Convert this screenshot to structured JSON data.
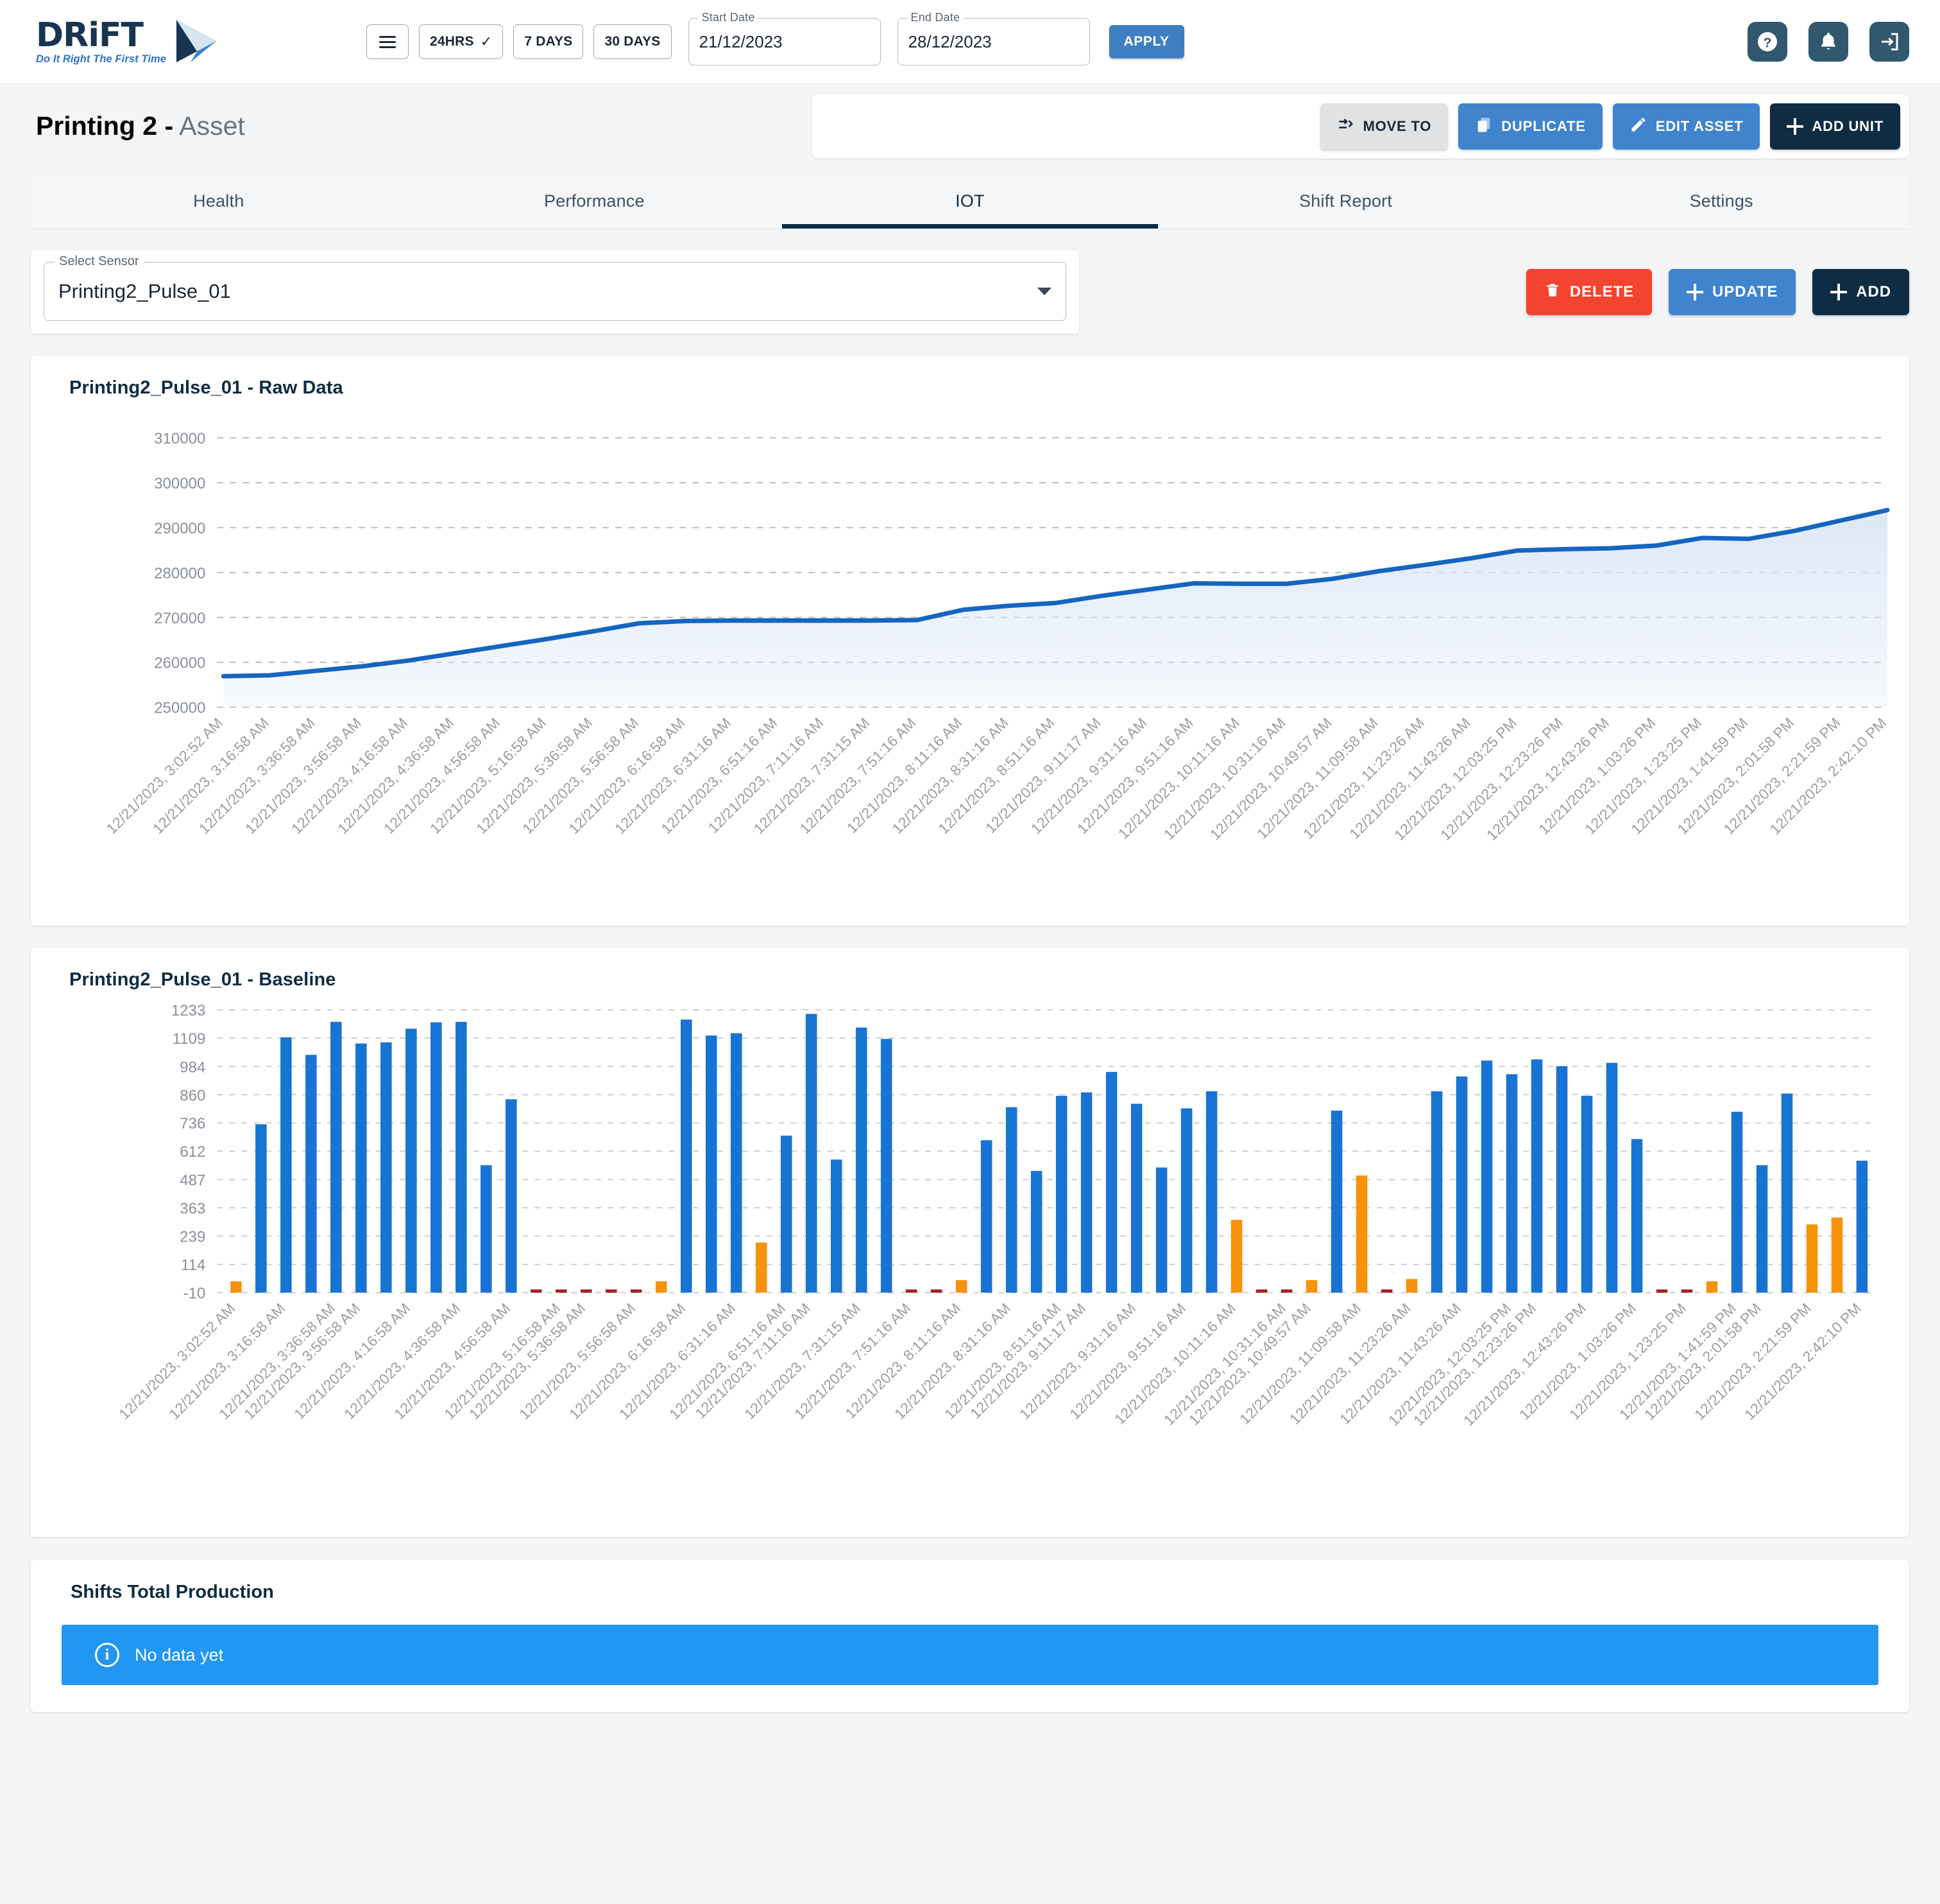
{
  "brand": {
    "name": "DRiFT",
    "tagline": "Do It Right The First Time"
  },
  "header": {
    "menu_icon": "hamburger-menu-icon",
    "ranges": [
      {
        "label": "24HRS",
        "selected": true,
        "check": "✓"
      },
      {
        "label": "7 DAYS",
        "selected": false
      },
      {
        "label": "30 DAYS",
        "selected": false
      }
    ],
    "start_date": {
      "label": "Start Date",
      "value": "21/12/2023"
    },
    "end_date": {
      "label": "End Date",
      "value": "28/12/2023"
    },
    "apply_label": "APPLY",
    "icons": [
      "help-icon",
      "notifications-bell-icon",
      "logout-icon"
    ],
    "accent_blue": "#3f7fc1",
    "icon_tile_color": "#31586e"
  },
  "page": {
    "title_bold": "Printing 2 -",
    "title_muted": "Asset",
    "actions": [
      {
        "label": "MOVE TO",
        "icon": "move-to-icon",
        "style": "grey"
      },
      {
        "label": "DUPLICATE",
        "icon": "duplicate-icon",
        "style": "blue"
      },
      {
        "label": "EDIT ASSET",
        "icon": "pencil-icon",
        "style": "blue"
      },
      {
        "label": "ADD UNIT",
        "icon": "plus-icon",
        "style": "navy"
      }
    ]
  },
  "tabs": [
    {
      "label": "Health",
      "active": false
    },
    {
      "label": "Performance",
      "active": false
    },
    {
      "label": "IOT",
      "active": true
    },
    {
      "label": "Shift Report",
      "active": false
    },
    {
      "label": "Settings",
      "active": false
    }
  ],
  "sensor": {
    "label": "Select Sensor",
    "value": "Printing2_Pulse_01",
    "actions": [
      {
        "label": "DELETE",
        "icon": "trash-icon",
        "style": "red"
      },
      {
        "label": "UPDATE",
        "icon": "plus-icon",
        "style": "blue"
      },
      {
        "label": "ADD",
        "icon": "plus-icon",
        "style": "navy"
      }
    ]
  },
  "shifts": {
    "title": "Shifts Total Production",
    "no_data_text": "No data yet",
    "info_icon": "info-icon",
    "banner_color": "#2196f3"
  },
  "chart_data": [
    {
      "id": "raw",
      "type": "area",
      "title": "Printing2_Pulse_01 - Raw Data",
      "xlabel": "",
      "ylabel": "",
      "ylim": [
        250000,
        313000
      ],
      "yticks": [
        250000,
        260000,
        270000,
        280000,
        290000,
        300000,
        310000
      ],
      "grid": true,
      "legend": "none",
      "line_color": "#1565c0",
      "fill_color": "#dbe7f7",
      "x": [
        "12/21/2023, 3:02:52 AM",
        "12/21/2023, 3:16:58 AM",
        "12/21/2023, 3:36:58 AM",
        "12/21/2023, 3:56:58 AM",
        "12/21/2023, 4:16:58 AM",
        "12/21/2023, 4:36:58 AM",
        "12/21/2023, 4:56:58 AM",
        "12/21/2023, 5:16:58 AM",
        "12/21/2023, 5:36:58 AM",
        "12/21/2023, 5:56:58 AM",
        "12/21/2023, 6:16:58 AM",
        "12/21/2023, 6:31:16 AM",
        "12/21/2023, 6:51:16 AM",
        "12/21/2023, 7:11:16 AM",
        "12/21/2023, 7:31:15 AM",
        "12/21/2023, 7:51:16 AM",
        "12/21/2023, 8:11:16 AM",
        "12/21/2023, 8:31:16 AM",
        "12/21/2023, 8:51:16 AM",
        "12/21/2023, 9:11:17 AM",
        "12/21/2023, 9:31:16 AM",
        "12/21/2023, 9:51:16 AM",
        "12/21/2023, 10:11:16 AM",
        "12/21/2023, 10:31:16 AM",
        "12/21/2023, 10:49:57 AM",
        "12/21/2023, 11:09:58 AM",
        "12/21/2023, 11:23:26 AM",
        "12/21/2023, 11:43:26 AM",
        "12/21/2023, 12:03:25 PM",
        "12/21/2023, 12:23:26 PM",
        "12/21/2023, 12:43:26 PM",
        "12/21/2023, 1:03:26 PM",
        "12/21/2023, 1:23:25 PM",
        "12/21/2023, 1:41:59 PM",
        "12/21/2023, 2:01:58 PM",
        "12/21/2023, 2:21:59 PM",
        "12/21/2023, 2:42:10 PM"
      ],
      "y": [
        256900,
        257100,
        258100,
        259100,
        260400,
        262000,
        263600,
        265200,
        266900,
        268700,
        269200,
        269300,
        269300,
        269300,
        269300,
        269400,
        271700,
        272600,
        273200,
        274800,
        276200,
        277600,
        277500,
        277500,
        278600,
        280300,
        281700,
        283200,
        284900,
        285200,
        285400,
        286000,
        287700,
        287500,
        289300,
        291600,
        293900
      ]
    },
    {
      "id": "baseline",
      "type": "bar",
      "title": "Printing2_Pulse_01 - Baseline",
      "xlabel": "",
      "ylabel": "",
      "ylim": [
        -10,
        1233
      ],
      "yticks": [
        -10,
        114,
        239,
        363,
        487,
        612,
        736,
        860,
        984,
        1109,
        1233
      ],
      "grid": true,
      "legend": "none",
      "colors": {
        "primary": "#1874d2",
        "secondary": "#f7920b",
        "zero": "#a32020"
      },
      "categories": [
        "12/21/2023, 3:02:52 AM",
        "12/21/2023, 3:16:58 AM",
        "12/21/2023, 3:36:58 AM",
        "12/21/2023, 3:56:58 AM",
        "12/21/2023, 4:16:58 AM",
        "12/21/2023, 4:36:58 AM",
        "12/21/2023, 4:56:58 AM",
        "12/21/2023, 5:16:58 AM",
        "12/21/2023, 5:36:58 AM",
        "12/21/2023, 5:56:58 AM",
        "12/21/2023, 6:16:58 AM",
        "12/21/2023, 6:31:16 AM",
        "12/21/2023, 6:51:16 AM",
        "12/21/2023, 7:11:16 AM",
        "12/21/2023, 7:31:15 AM",
        "12/21/2023, 7:51:16 AM",
        "12/21/2023, 8:11:16 AM",
        "12/21/2023, 8:31:16 AM",
        "12/21/2023, 8:51:16 AM",
        "12/21/2023, 9:11:17 AM",
        "12/21/2023, 9:31:16 AM",
        "12/21/2023, 9:51:16 AM",
        "12/21/2023, 10:11:16 AM",
        "12/21/2023, 10:31:16 AM",
        "12/21/2023, 10:49:57 AM",
        "12/21/2023, 11:09:58 AM",
        "12/21/2023, 11:23:26 AM",
        "12/21/2023, 11:43:26 AM",
        "12/21/2023, 12:03:25 PM",
        "12/21/2023, 12:23:26 PM",
        "12/21/2023, 12:43:26 PM",
        "12/21/2023, 1:03:26 PM",
        "12/21/2023, 1:23:25 PM",
        "12/21/2023, 1:41:59 PM",
        "12/21/2023, 2:01:58 PM",
        "12/21/2023, 2:21:59 PM",
        "12/21/2023, 2:42:10 PM"
      ],
      "bars": [
        {
          "v": 40,
          "c": "secondary"
        },
        {
          "v": 730,
          "c": "primary"
        },
        {
          "v": 1112,
          "c": "primary"
        },
        {
          "v": 1035,
          "c": "primary"
        },
        {
          "v": 1180,
          "c": "primary"
        },
        {
          "v": 1085,
          "c": "primary"
        },
        {
          "v": 1090,
          "c": "primary"
        },
        {
          "v": 1150,
          "c": "primary"
        },
        {
          "v": 1178,
          "c": "primary"
        },
        {
          "v": 1180,
          "c": "primary"
        },
        {
          "v": 550,
          "c": "primary"
        },
        {
          "v": 840,
          "c": "primary"
        },
        {
          "v": 2,
          "c": "zero"
        },
        {
          "v": 2,
          "c": "zero"
        },
        {
          "v": 2,
          "c": "zero"
        },
        {
          "v": 2,
          "c": "zero"
        },
        {
          "v": 2,
          "c": "zero"
        },
        {
          "v": 40,
          "c": "secondary"
        },
        {
          "v": 1190,
          "c": "primary"
        },
        {
          "v": 1120,
          "c": "primary"
        },
        {
          "v": 1130,
          "c": "primary"
        },
        {
          "v": 210,
          "c": "secondary"
        },
        {
          "v": 680,
          "c": "primary"
        },
        {
          "v": 1215,
          "c": "primary"
        },
        {
          "v": 575,
          "c": "primary"
        },
        {
          "v": 1155,
          "c": "primary"
        },
        {
          "v": 1105,
          "c": "primary"
        },
        {
          "v": 2,
          "c": "zero"
        },
        {
          "v": 2,
          "c": "zero"
        },
        {
          "v": 45,
          "c": "secondary"
        },
        {
          "v": 660,
          "c": "primary"
        },
        {
          "v": 805,
          "c": "primary"
        },
        {
          "v": 525,
          "c": "primary"
        },
        {
          "v": 855,
          "c": "primary"
        },
        {
          "v": 870,
          "c": "primary"
        },
        {
          "v": 960,
          "c": "primary"
        },
        {
          "v": 820,
          "c": "primary"
        },
        {
          "v": 540,
          "c": "primary"
        },
        {
          "v": 800,
          "c": "primary"
        },
        {
          "v": 875,
          "c": "primary"
        },
        {
          "v": 310,
          "c": "secondary"
        },
        {
          "v": 2,
          "c": "zero"
        },
        {
          "v": 2,
          "c": "zero"
        },
        {
          "v": 45,
          "c": "secondary"
        },
        {
          "v": 790,
          "c": "primary"
        },
        {
          "v": 505,
          "c": "secondary"
        },
        {
          "v": 2,
          "c": "zero"
        },
        {
          "v": 50,
          "c": "secondary"
        },
        {
          "v": 875,
          "c": "primary"
        },
        {
          "v": 940,
          "c": "primary"
        },
        {
          "v": 1010,
          "c": "primary"
        },
        {
          "v": 950,
          "c": "primary"
        },
        {
          "v": 1015,
          "c": "primary"
        },
        {
          "v": 985,
          "c": "primary"
        },
        {
          "v": 855,
          "c": "primary"
        },
        {
          "v": 1000,
          "c": "primary"
        },
        {
          "v": 665,
          "c": "primary"
        },
        {
          "v": 2,
          "c": "zero"
        },
        {
          "v": 2,
          "c": "zero"
        },
        {
          "v": 40,
          "c": "secondary"
        },
        {
          "v": 785,
          "c": "primary"
        },
        {
          "v": 550,
          "c": "primary"
        },
        {
          "v": 865,
          "c": "primary"
        },
        {
          "v": 290,
          "c": "secondary"
        },
        {
          "v": 320,
          "c": "secondary"
        },
        {
          "v": 570,
          "c": "primary"
        }
      ]
    }
  ]
}
